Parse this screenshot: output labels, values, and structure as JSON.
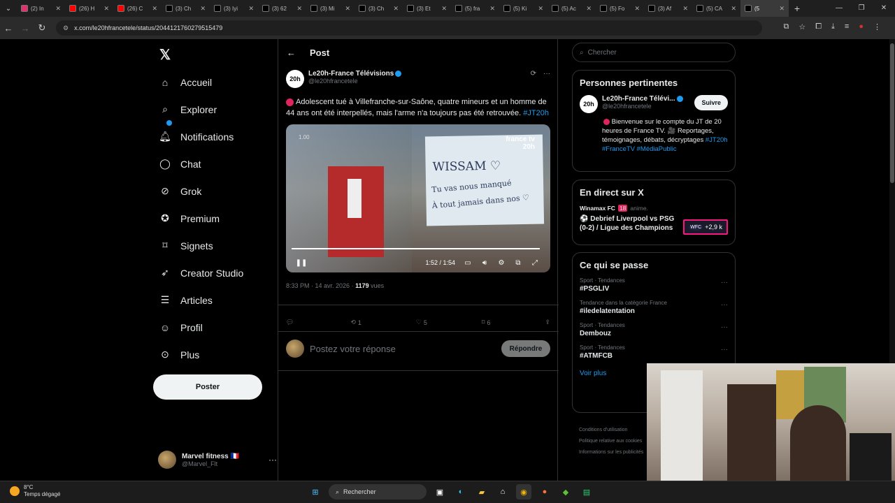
{
  "browser": {
    "tabs": [
      {
        "label": "(2) In",
        "color": "#e1306c"
      },
      {
        "label": "(26) H",
        "color": "#ff0000"
      },
      {
        "label": "(26) C",
        "color": "#ff0000"
      },
      {
        "label": "(3) Ch",
        "color": "#000000"
      },
      {
        "label": "(3) Iyi",
        "color": "#000000"
      },
      {
        "label": "(3) 62",
        "color": "#000000"
      },
      {
        "label": "(3) Mi",
        "color": "#000000"
      },
      {
        "label": "(3) Ch",
        "color": "#000000"
      },
      {
        "label": "(3) Et",
        "color": "#000000"
      },
      {
        "label": "(5) fra",
        "color": "#000000"
      },
      {
        "label": "(5) Ki",
        "color": "#000000"
      },
      {
        "label": "(5) Ac",
        "color": "#000000"
      },
      {
        "label": "(5) Fo",
        "color": "#000000"
      },
      {
        "label": "(3) Af",
        "color": "#000000"
      },
      {
        "label": "(5) CA",
        "color": "#000000"
      },
      {
        "label": "(5",
        "color": "#000000",
        "active": true
      }
    ],
    "url": "x.com/le20hfrancetele/status/2044121760279515479"
  },
  "nav": {
    "items": [
      {
        "label": "Accueil",
        "icon": "home-icon"
      },
      {
        "label": "Explorer",
        "icon": "search-icon"
      },
      {
        "label": "Notifications",
        "icon": "bell-icon"
      },
      {
        "label": "Chat",
        "icon": "chat-icon"
      },
      {
        "label": "Grok",
        "icon": "grok-icon"
      },
      {
        "label": "Premium",
        "icon": "premium-icon"
      },
      {
        "label": "Signets",
        "icon": "bookmark-icon"
      },
      {
        "label": "Creator Studio",
        "icon": "rocket-icon"
      },
      {
        "label": "Articles",
        "icon": "article-icon"
      },
      {
        "label": "Profil",
        "icon": "user-icon"
      },
      {
        "label": "Plus",
        "icon": "more-icon"
      }
    ],
    "post_button": "Poster",
    "account": {
      "name": "Marvel fitness 🇫🇷",
      "handle": "@Marvel_Flt"
    }
  },
  "post": {
    "header": "Post",
    "author": {
      "name": "Le20h-France Télévisions",
      "handle": "@le20hfrancetele",
      "avatar_text": "20h"
    },
    "text_main": "Adolescent tué à Villefranche-sur-Saône, quatre mineurs et un homme de 44 ans ont été interpellés, mais l'arme n'a toujours pas été retrouvée.",
    "hashtag": "#JT20h",
    "video": {
      "speed": "1.00",
      "brand": "france tv",
      "brand_sub": "20h",
      "sign_line1": "WISSAM ♡",
      "sign_line2": "Tu vas nous manqué",
      "sign_line3": "À tout jamais dans nos ♡",
      "time": "1:52 / 1:54",
      "progress": 0.98
    },
    "meta_time": "8:33 PM · 14 avr. 2026 · ",
    "meta_views_count": "1179",
    "meta_views_label": " vues",
    "actions": {
      "replies": "",
      "reposts": "1",
      "likes": "5",
      "bookmarks": "6"
    },
    "reply_placeholder": "Postez votre réponse",
    "reply_button": "Répondre"
  },
  "sidebar": {
    "search_placeholder": "Chercher",
    "relevant": {
      "title": "Personnes pertinentes",
      "name": "Le20h-France Télévi...",
      "handle": "@le20hfrancetele",
      "follow": "Suivre",
      "bio": "Bienvenue sur le compte du JT de 20 heures de France TV. 🎥 Reportages, témoignages, débats, décryptages",
      "bio_tags": "#JT20h #FranceTV #MédiaPublic"
    },
    "live": {
      "title": "En direct sur X",
      "channel": "Winamax FC",
      "channel_extra": "18",
      "channel_suffix": "anime.",
      "stream_title": "⚽ Debrief Liverpool vs PSG (0-2) / Ligue des Champions",
      "viewers": "+2,9 k",
      "badge_logo": "WFC"
    },
    "trends": {
      "title": "Ce qui se passe",
      "items": [
        {
          "category": "Sport · Tendances",
          "name": "#PSGLIV"
        },
        {
          "category": "Tendance dans la catégorie France",
          "name": "#iledelatentation"
        },
        {
          "category": "Sport · Tendances",
          "name": "Dembouz"
        },
        {
          "category": "Sport · Tendances",
          "name": "#ATMFCB"
        }
      ],
      "see_more": "Voir plus"
    },
    "footer": [
      "Conditions d'utilisation",
      "Politique relative aux cookies",
      "Informations sur les publicités"
    ]
  },
  "taskbar": {
    "temp": "8°C",
    "weather": "Temps dégagé",
    "search": "Rechercher"
  }
}
